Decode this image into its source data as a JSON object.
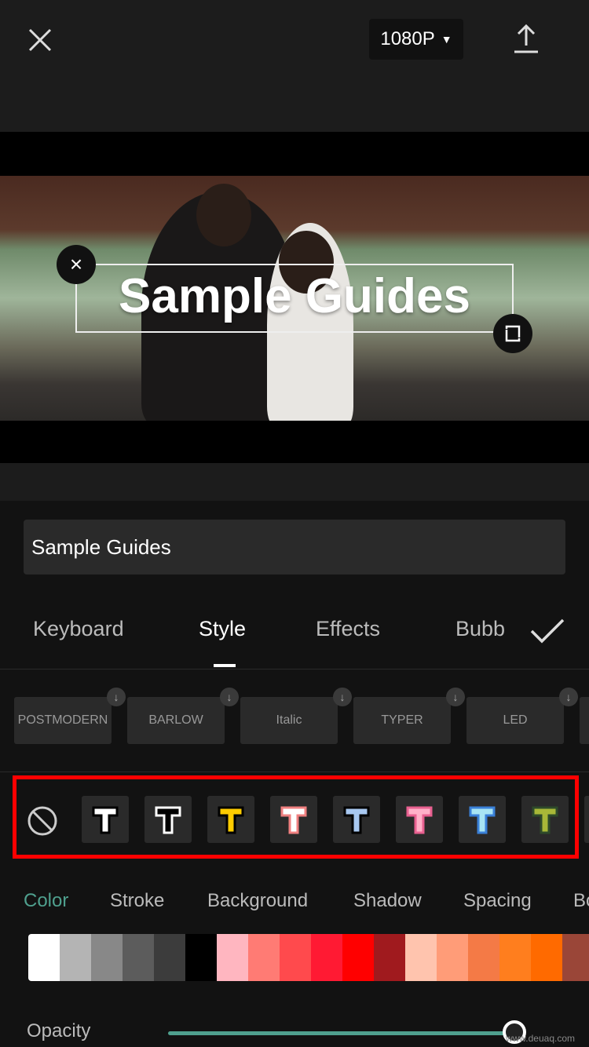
{
  "header": {
    "resolution": "1080P",
    "close_icon": "close-icon",
    "export_icon": "upload-icon"
  },
  "preview": {
    "overlay_text": "Sample Guides"
  },
  "editor": {
    "text_value": "Sample Guides",
    "tabs": [
      {
        "label": "Keyboard"
      },
      {
        "label": "Style",
        "active": true
      },
      {
        "label": "Effects"
      },
      {
        "label": "Bubb"
      }
    ],
    "fonts": [
      "POSTMODERN",
      "BARLOW",
      "Italic",
      "TYPER",
      "LED"
    ],
    "presets": [
      {
        "fill": "#ffffff",
        "stroke": "#000000"
      },
      {
        "fill": "#000000",
        "stroke": "#ffffff"
      },
      {
        "fill": "#ffcc00",
        "stroke": "#000000"
      },
      {
        "fill": "#ffffff",
        "stroke": "#f08080"
      },
      {
        "fill": "#a8c8f0",
        "stroke": "#000000"
      },
      {
        "fill": "#ffb0c8",
        "stroke": "#e86090"
      },
      {
        "fill": "#a8e4f4",
        "stroke": "#3a80d8"
      },
      {
        "fill": "#a8b838",
        "stroke": "#2e4a2a"
      }
    ],
    "style_tabs": [
      {
        "label": "Color",
        "active": true
      },
      {
        "label": "Stroke"
      },
      {
        "label": "Background"
      },
      {
        "label": "Shadow"
      },
      {
        "label": "Spacing"
      },
      {
        "label": "Bo"
      }
    ],
    "swatches": [
      "#ffffff",
      "#b4b4b4",
      "#888888",
      "#5c5c5c",
      "#3c3c3c",
      "#000000",
      "#ffb6c0",
      "#ff7b74",
      "#ff4a4d",
      "#ff1a33",
      "#ff0000",
      "#a01a1e",
      "#ffc4ae",
      "#ff9c78",
      "#f47a46",
      "#ff7e1e",
      "#ff6a00",
      "#9a4638"
    ],
    "opacity_label": "Opacity",
    "opacity_value": 100,
    "accent": "#4fa08e",
    "highlight": "#ff0000"
  },
  "watermark": "www.deuaq.com"
}
